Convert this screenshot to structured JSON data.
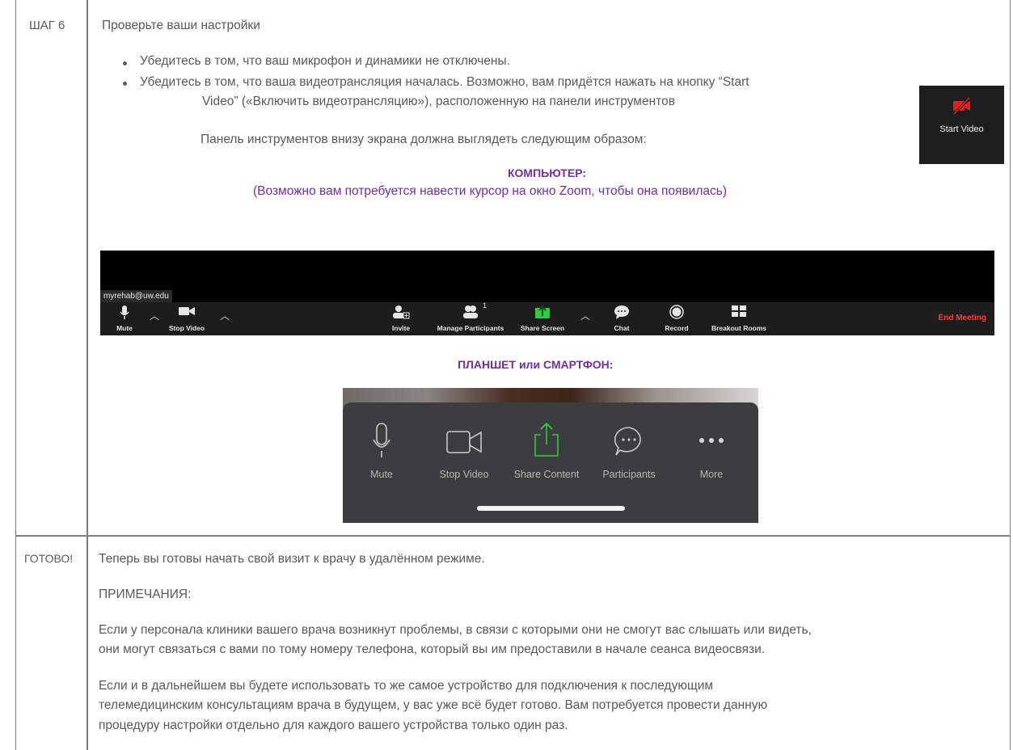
{
  "step6": {
    "label": "ШАГ 6",
    "title": "Проверьте ваши настройки",
    "bullet1": "Убедитесь в том, что ваш микрофон и динамики не отключены.",
    "bullet2_line1": "Убедитесь в том, что ваша видеотрансляция началась. Возможно, вам придётся нажать на кнопку “Start",
    "bullet2_line2": "Video” («Включить видеотрансляцию»), расположенную на панели инструментов",
    "toolbar_note": "Панель инструментов внизу экрана должна выглядеть следующим образом:",
    "computer_heading": "КОМПЬЮТЕР:",
    "computer_note": "(Возможно вам потребуется навести курсор на окно Zoom, чтобы она появилась)",
    "tablet_heading": "ПЛАНШЕТ или СМАРТФОН:",
    "start_video_icon_label": "Start Video"
  },
  "desktop_toolbar": {
    "email": "myrehab@uw.edu",
    "mute": "Mute",
    "stop_video": "Stop Video",
    "invite": "Invite",
    "manage_participants": "Manage Participants",
    "participants_count": "1",
    "share_screen": "Share Screen",
    "chat": "Chat",
    "record": "Record",
    "breakout_rooms": "Breakout Rooms",
    "end_meeting": "End Meeting"
  },
  "mobile_toolbar": {
    "mute": "Mute",
    "stop_video": "Stop Video",
    "share_content": "Share Content",
    "participants": "Participants",
    "more": "More"
  },
  "done": {
    "label": "ГОТОВО!",
    "line1": "Теперь вы готовы начать свой визит к врачу в удалённом режиме.",
    "notes_heading": "ПРИМЕЧАНИЯ:",
    "p1_line1": "Если у персонала клиники вашего врача возникнут проблемы, в связи с которыми они не смогут вас слышать или видеть,",
    "p1_line2": "они могут связаться с вами по тому номеру телефона, который вы им предоставили в начале сеанса видеосвязи.",
    "p2_line1": "Если и в дальнейшем вы будете использовать то же самое устройство для подключения к последующим",
    "p2_line2": "телемедицинским консультациям врача в будущем, у вас уже всё будет готово. Вам потребуется провести данную",
    "p2_line3": "процедуру настройки отдельно для каждого вашего устройства только один раз."
  },
  "colors": {
    "text": "#595959",
    "heading_purple": "#7030a0",
    "end_meeting_red": "#ff3b3b",
    "share_green": "#2ecc40"
  }
}
